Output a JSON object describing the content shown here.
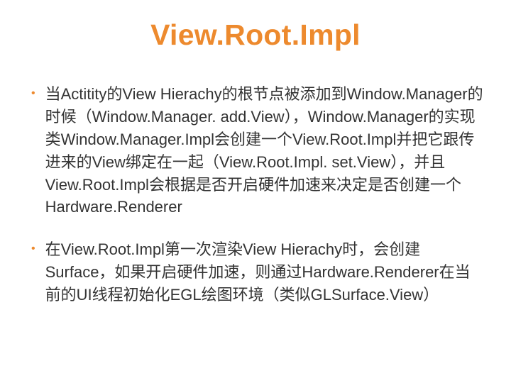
{
  "slide": {
    "title": "View.Root.Impl",
    "bullets": [
      {
        "text": "当Actitity的View Hierachy的根节点被添加到Window.Manager的时候（Window.Manager. add.View），Window.Manager的实现类Window.Manager.Impl会创建一个View.Root.Impl并把它跟传进来的View绑定在一起（View.Root.Impl. set.View），并且View.Root.Impl会根据是否开启硬件加速来决定是否创建一个Hardware.Renderer"
      },
      {
        "text": "在View.Root.Impl第一次渲染View Hierachy时，会创建Surface，如果开启硬件加速，则通过Hardware.Renderer在当前的UI线程初始化EGL绘图环境（类似GLSurface.View）"
      }
    ]
  }
}
